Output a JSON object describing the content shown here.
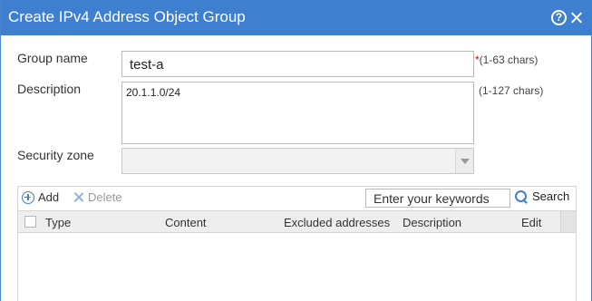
{
  "dialog": {
    "title": "Create IPv4 Address Object Group",
    "help_glyph": "?"
  },
  "form": {
    "group_name": {
      "label": "Group name",
      "value": "test-a",
      "required_mark": "*",
      "hint": "(1-63 chars)"
    },
    "description": {
      "label": "Description",
      "value": "20.1.1.0/24",
      "hint": "(1-127 chars)"
    },
    "security_zone": {
      "label": "Security zone",
      "value": ""
    }
  },
  "toolbar": {
    "add_label": "Add",
    "delete_label": "Delete",
    "search_placeholder": "Enter your keywords",
    "search_label": "Search"
  },
  "table": {
    "columns": [
      "Type",
      "Content",
      "Excluded addresses",
      "Description",
      "Edit"
    ],
    "rows": []
  },
  "colors": {
    "titlebar": "#3f7fcf",
    "accent_icon": "#3f7fcf",
    "required": "#ee0000"
  }
}
